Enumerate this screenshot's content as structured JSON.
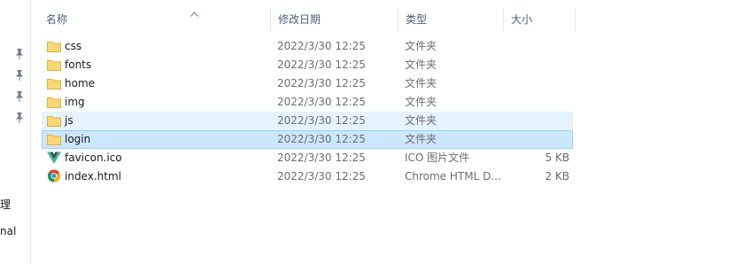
{
  "sidebar": {
    "text1": "理",
    "text2": "nal"
  },
  "header": {
    "name": "名称",
    "modified": "修改日期",
    "type": "类型",
    "size": "大小"
  },
  "files": [
    {
      "name": "css",
      "modified": "2022/3/30 12:25",
      "type": "文件夹",
      "size": "",
      "icon": "folder-icon",
      "state": "normal"
    },
    {
      "name": "fonts",
      "modified": "2022/3/30 12:25",
      "type": "文件夹",
      "size": "",
      "icon": "folder-icon",
      "state": "normal"
    },
    {
      "name": "home",
      "modified": "2022/3/30 12:25",
      "type": "文件夹",
      "size": "",
      "icon": "folder-icon",
      "state": "normal"
    },
    {
      "name": "img",
      "modified": "2022/3/30 12:25",
      "type": "文件夹",
      "size": "",
      "icon": "folder-icon",
      "state": "normal"
    },
    {
      "name": "js",
      "modified": "2022/3/30 12:25",
      "type": "文件夹",
      "size": "",
      "icon": "folder-icon",
      "state": "hover"
    },
    {
      "name": "login",
      "modified": "2022/3/30 12:25",
      "type": "文件夹",
      "size": "",
      "icon": "folder-icon",
      "state": "selected"
    },
    {
      "name": "favicon.ico",
      "modified": "2022/3/30 12:25",
      "type": "ICO 图片文件",
      "size": "5 KB",
      "icon": "vue-logo-icon",
      "state": "normal"
    },
    {
      "name": "index.html",
      "modified": "2022/3/30 12:25",
      "type": "Chrome HTML D...",
      "size": "2 KB",
      "icon": "chrome-icon",
      "state": "normal"
    }
  ],
  "colors": {
    "folder": "#f8d775",
    "selected_bg": "#cce8ff",
    "selected_border": "#99d1ff",
    "hover_bg": "#e5f3ff",
    "header_text": "#4c607a"
  }
}
